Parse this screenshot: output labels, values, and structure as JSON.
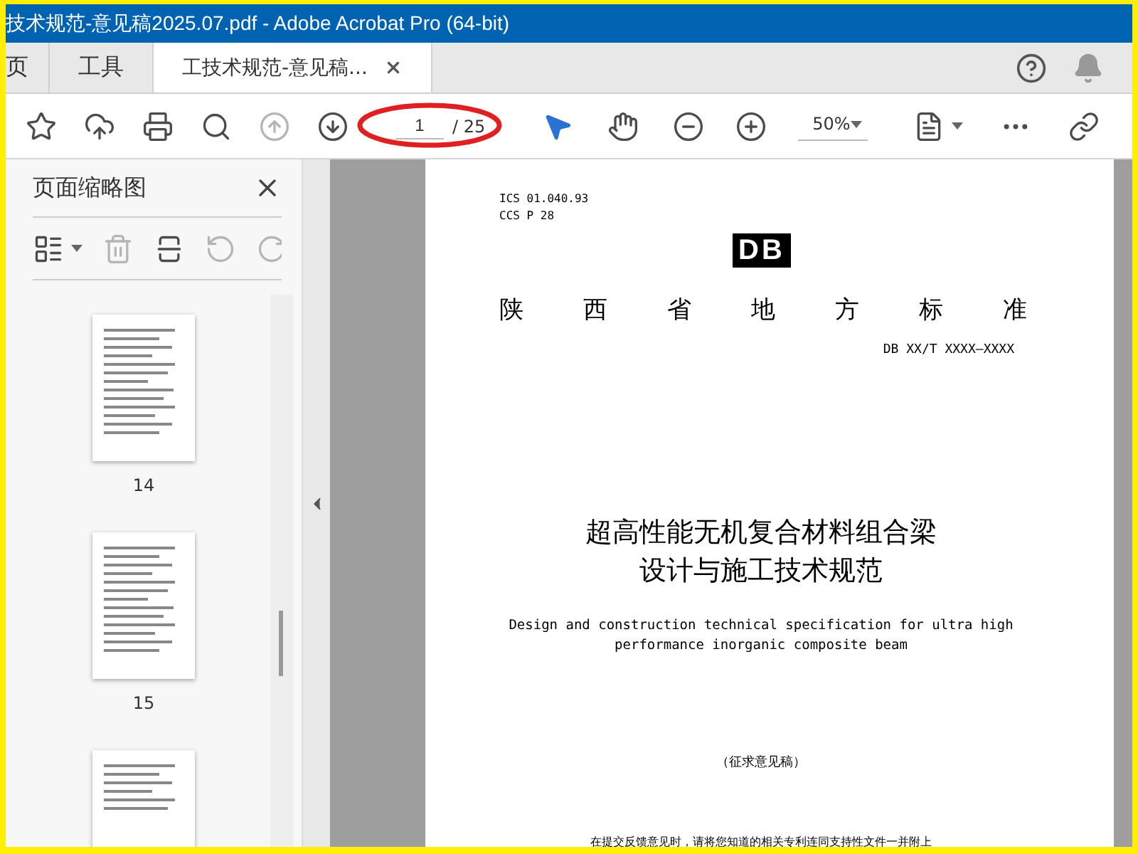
{
  "window": {
    "title": "技术规范-意见稿2025.07.pdf - Adobe Acrobat Pro (64-bit)"
  },
  "tabs": [
    {
      "label": "页",
      "selected": false,
      "closable": false
    },
    {
      "label": "工具",
      "selected": false,
      "closable": false
    },
    {
      "label": "工技术规范-意见稿...",
      "selected": true,
      "closable": true
    }
  ],
  "toolbar": {
    "buttons": [
      {
        "kind": "star",
        "disabled": false
      },
      {
        "kind": "upload",
        "disabled": false
      },
      {
        "kind": "print",
        "disabled": false
      },
      {
        "kind": "search",
        "disabled": false
      },
      {
        "kind": "prev",
        "disabled": true
      },
      {
        "kind": "next",
        "disabled": false
      }
    ],
    "page_number": "1",
    "page_total": "/ 25",
    "tools": [
      {
        "kind": "pointer",
        "selected": true
      },
      {
        "kind": "hand",
        "selected": false
      }
    ],
    "zoom_buttons": [
      {
        "kind": "zoom-out"
      },
      {
        "kind": "zoom-in"
      }
    ],
    "zoom": "50%",
    "extra_buttons": [
      {
        "kind": "fit"
      },
      {
        "kind": "more"
      },
      {
        "kind": "link"
      }
    ]
  },
  "sidebar": {
    "title": "页面缩略图",
    "buttons": [
      {
        "kind": "options",
        "disabled": false
      },
      {
        "kind": "delete",
        "disabled": true
      },
      {
        "kind": "insert",
        "disabled": false
      },
      {
        "kind": "rotate-left",
        "disabled": true
      },
      {
        "kind": "rotate-right",
        "disabled": true
      }
    ],
    "thumbnails": [
      {
        "kind": "labeled",
        "label": "14"
      },
      {
        "kind": "labeled",
        "label": "15"
      },
      {
        "kind": "cut"
      }
    ]
  },
  "document": {
    "ics": "ICS  01.040.93",
    "ccs": "CCS P 28",
    "logo": "DB",
    "heading": "陕西省地方标准",
    "code": "DB XX/T XXXX—XXXX",
    "title_lines": [
      "超高性能无机复合材料组合梁",
      "设计与施工技术规范"
    ],
    "english_lines": [
      "Design and construction technical specification for ultra high",
      "performance inorganic composite beam"
    ],
    "draft": "（征求意见稿）",
    "notice": "在提交反馈意见时，请将您知道的相关专利连同支持性文件一并附上"
  }
}
